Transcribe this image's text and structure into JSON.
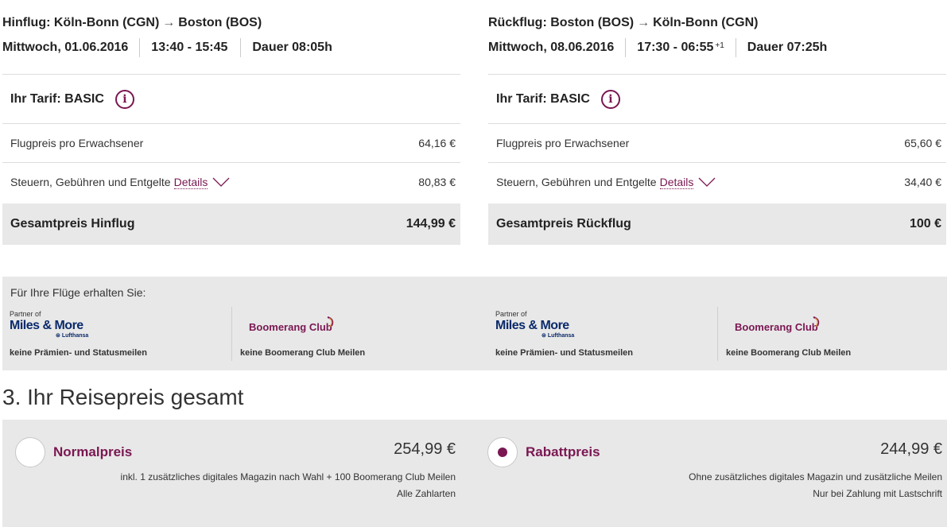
{
  "outbound": {
    "route_from": "Hinflug: Köln-Bonn (CGN)",
    "arrow": "→",
    "route_to": "Boston (BOS)",
    "date": "Mittwoch, 01.06.2016",
    "time": "13:40 - 15:45",
    "time_sup": "",
    "duration": "Dauer 08:05h",
    "tariff": "Ihr Tarif: BASIC",
    "fare_label": "Flugpreis pro Erwachsener",
    "fare_value": "64,16 €",
    "tax_label": "Steuern, Gebühren und Entgelte",
    "tax_details": "Details",
    "tax_value": "80,83 €",
    "total_label": "Gesamtpreis Hinflug",
    "total_value": "144,99 €"
  },
  "return": {
    "route_from": "Rückflug: Boston (BOS)",
    "arrow": "→",
    "route_to": "Köln-Bonn (CGN)",
    "date": "Mittwoch, 08.06.2016",
    "time": "17:30 - 06:55",
    "time_sup": "+1",
    "duration": "Dauer 07:25h",
    "tariff": "Ihr Tarif: BASIC",
    "fare_label": "Flugpreis pro Erwachsener",
    "fare_value": "65,60 €",
    "tax_label": "Steuern, Gebühren und Entgelte",
    "tax_details": "Details",
    "tax_value": "34,40 €",
    "total_label": "Gesamtpreis Rückflug",
    "total_value": "100 €"
  },
  "bonus": {
    "title": "Für Ihre Flüge erhalten Sie:",
    "mm_partner_of": "Partner of",
    "mm_logo": "Miles & More",
    "mm_lufthansa": "Lufthansa",
    "mm_note": "keine Prämien- und Statusmeilen",
    "bc_logo": "Boomerang Club",
    "bc_note": "keine Boomerang Club Meilen"
  },
  "summary": {
    "title": "3. Ihr Reisepreis gesamt",
    "normal": {
      "name": "Normalpreis",
      "price": "254,99 €",
      "line1": "inkl. 1 zusätzliches digitales Magazin nach Wahl + 100 Boomerang Club Meilen",
      "line2": "Alle Zahlarten"
    },
    "discount": {
      "name": "Rabattpreis",
      "price": "244,99 €",
      "line1": "Ohne zusätzliches digitales Magazin und zusätzliche Meilen",
      "line2": "Nur bei Zahlung mit Lastschrift"
    }
  },
  "colors": {
    "accent": "#7a1752",
    "panel": "#e8e8e8",
    "miles_more": "#0a2a6b"
  },
  "icons": [
    "info-icon",
    "chevron-down-icon",
    "radio-unchecked",
    "radio-checked"
  ]
}
